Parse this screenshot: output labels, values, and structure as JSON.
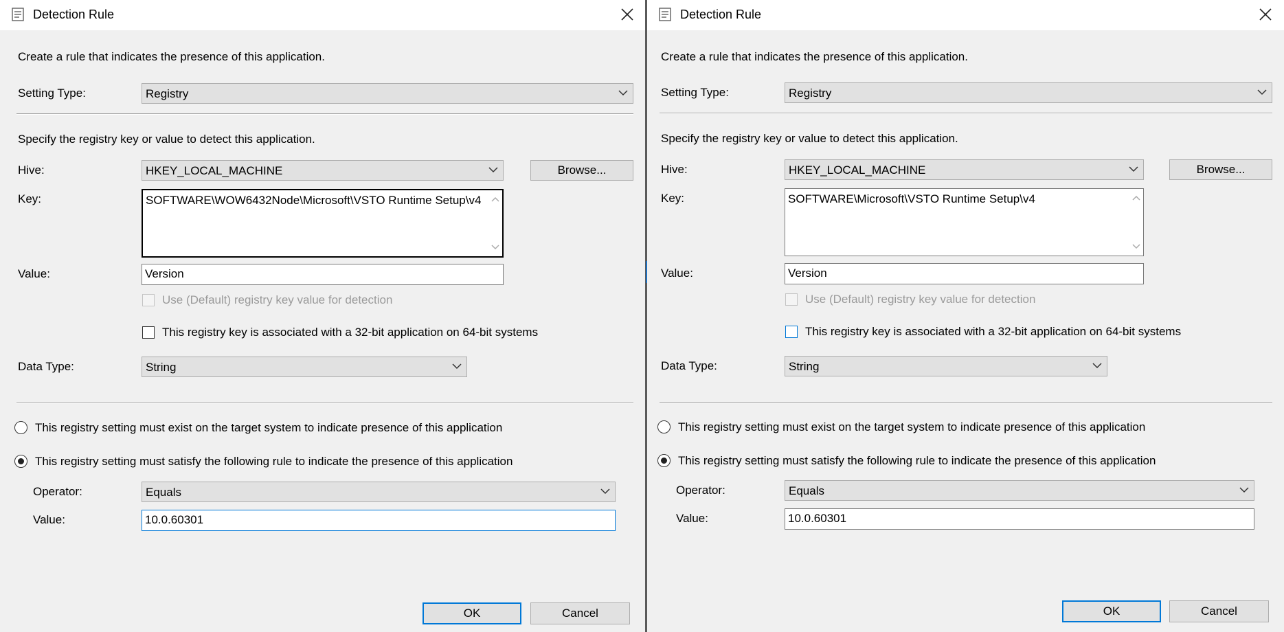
{
  "dialogs": [
    {
      "title": "Detection Rule",
      "intro": "Create a rule that indicates the presence of this application.",
      "setting_type_label": "Setting Type:",
      "setting_type_value": "Registry",
      "specify_text": "Specify the registry key or value to detect this application.",
      "hive_label": "Hive:",
      "hive_value": "HKEY_LOCAL_MACHINE",
      "browse_label": "Browse...",
      "key_label": "Key:",
      "key_value": "SOFTWARE\\WOW6432Node\\Microsoft\\VSTO Runtime Setup\\v4",
      "value_label": "Value:",
      "value_value": "Version",
      "use_default_label": "Use (Default) registry key value for detection",
      "bit32_label": "This registry key is associated with a 32-bit application on 64-bit systems",
      "data_type_label": "Data Type:",
      "data_type_value": "String",
      "radio_exist_label": "This registry setting must exist on the target system to indicate presence of this application",
      "radio_rule_label": "This registry setting must satisfy the following rule to indicate the presence of this application",
      "operator_label": "Operator:",
      "operator_value": "Equals",
      "rule_value_label": "Value:",
      "rule_value": "10.0.60301",
      "ok_label": "OK",
      "cancel_label": "Cancel"
    },
    {
      "title": "Detection Rule",
      "intro": "Create a rule that indicates the presence of this application.",
      "setting_type_label": "Setting Type:",
      "setting_type_value": "Registry",
      "specify_text": "Specify the registry key or value to detect this application.",
      "hive_label": "Hive:",
      "hive_value": "HKEY_LOCAL_MACHINE",
      "browse_label": "Browse...",
      "key_label": "Key:",
      "key_value": "SOFTWARE\\Microsoft\\VSTO Runtime Setup\\v4",
      "value_label": "Value:",
      "value_value": "Version",
      "use_default_label": "Use (Default) registry key value for detection",
      "bit32_label": "This registry key is associated with a 32-bit application on 64-bit systems",
      "data_type_label": "Data Type:",
      "data_type_value": "String",
      "radio_exist_label": "This registry setting must exist on the target system to indicate presence of this application",
      "radio_rule_label": "This registry setting must satisfy the following rule to indicate the presence of this application",
      "operator_label": "Operator:",
      "operator_value": "Equals",
      "rule_value_label": "Value:",
      "rule_value": "10.0.60301",
      "ok_label": "OK",
      "cancel_label": "Cancel"
    }
  ],
  "icons": {
    "title": "dialog-properties-icon",
    "close": "close-icon",
    "dropdown": "chevron-down-icon",
    "scroll_up": "scroll-up-icon",
    "scroll_down": "scroll-down-icon"
  }
}
